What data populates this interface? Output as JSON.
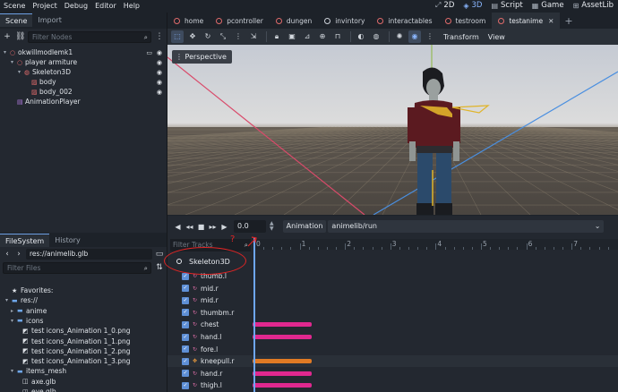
{
  "menubar": {
    "menus": [
      "Scene",
      "Project",
      "Debug",
      "Editor",
      "Help"
    ],
    "workspaces": [
      {
        "label": "2D",
        "icon": "2d-icon"
      },
      {
        "label": "3D",
        "icon": "3d-icon",
        "active": true
      },
      {
        "label": "Script",
        "icon": "script-icon"
      },
      {
        "label": "Game",
        "icon": "game-icon"
      },
      {
        "label": "AssetLib",
        "icon": "assetlib-icon"
      }
    ]
  },
  "scene_dock": {
    "tabs": [
      "Scene",
      "Import"
    ],
    "filter_placeholder": "Filter Nodes",
    "nodes": [
      {
        "label": "okwillmodlemk1",
        "depth": 0,
        "arrow": "▾",
        "icon": "node3d-icon"
      },
      {
        "label": "player armiture",
        "depth": 1,
        "arrow": "▾",
        "icon": "node3d-icon"
      },
      {
        "label": "Skeleton3D",
        "depth": 2,
        "arrow": "▾",
        "icon": "skeleton-icon"
      },
      {
        "label": "body",
        "depth": 3,
        "arrow": "",
        "icon": "mesh-icon"
      },
      {
        "label": "body_002",
        "depth": 3,
        "arrow": "",
        "icon": "mesh-icon"
      },
      {
        "label": "AnimationPlayer",
        "depth": 1,
        "arrow": "",
        "icon": "animplayer-icon"
      }
    ]
  },
  "filesystem_dock": {
    "tabs": [
      "FileSystem",
      "History"
    ],
    "path": "res://animelib.glb",
    "filter_placeholder": "Filter Files",
    "items": [
      {
        "label": "Favorites:",
        "depth": 0,
        "arrow": "",
        "icon": "star-icon"
      },
      {
        "label": "res://",
        "depth": 0,
        "arrow": "▾",
        "icon": "folder-icon"
      },
      {
        "label": "anime",
        "depth": 1,
        "arrow": "▸",
        "icon": "folder-icon"
      },
      {
        "label": "icons",
        "depth": 1,
        "arrow": "▾",
        "icon": "folder-icon"
      },
      {
        "label": "test icons_Animation 1_0.png",
        "depth": 2,
        "arrow": "",
        "icon": "image-icon"
      },
      {
        "label": "test icons_Animation 1_1.png",
        "depth": 2,
        "arrow": "",
        "icon": "image-icon"
      },
      {
        "label": "test icons_Animation 1_2.png",
        "depth": 2,
        "arrow": "",
        "icon": "image-icon"
      },
      {
        "label": "test icons_Animation 1_3.png",
        "depth": 2,
        "arrow": "",
        "icon": "image-icon"
      },
      {
        "label": "items_mesh",
        "depth": 1,
        "arrow": "▾",
        "icon": "folder-icon"
      },
      {
        "label": "axe.glb",
        "depth": 2,
        "arrow": "",
        "icon": "scene-file-icon"
      },
      {
        "label": "eye.glb",
        "depth": 2,
        "arrow": "",
        "icon": "scene-file-icon"
      }
    ]
  },
  "editor_tabs": [
    {
      "label": "home"
    },
    {
      "label": "pcontroller"
    },
    {
      "label": "dungen"
    },
    {
      "label": "invintory"
    },
    {
      "label": "interactables"
    },
    {
      "label": "testroom"
    },
    {
      "label": "testanime",
      "active": true
    }
  ],
  "viewport": {
    "transform_label": "Transform",
    "view_label": "View",
    "perspective_label": "Perspective"
  },
  "animation": {
    "time_value": "0.0",
    "animation_label": "Animation",
    "current_animation": "animelib/run",
    "filter_tracks_placeholder": "Filter Tracks",
    "ruler_numbers": [
      "0",
      "1",
      "2",
      "3",
      "4",
      "5",
      "6",
      "7"
    ],
    "annotation_glyph": "?",
    "root_track": "Skeleton3D",
    "tracks": [
      {
        "label": "thumb.l",
        "type": "rotation",
        "keyed": false
      },
      {
        "label": "mid.r",
        "type": "rotation",
        "keyed": false
      },
      {
        "label": "mid.r",
        "type": "rotation",
        "keyed": false
      },
      {
        "label": "thumbm.r",
        "type": "rotation",
        "keyed": false
      },
      {
        "label": "chest",
        "type": "rotation",
        "keyed": true
      },
      {
        "label": "hand.l",
        "type": "rotation",
        "keyed": true
      },
      {
        "label": "fore.l",
        "type": "rotation",
        "keyed": false
      },
      {
        "label": "kneepull.r",
        "type": "position",
        "keyed": true
      },
      {
        "label": "hand.r",
        "type": "rotation",
        "keyed": true
      },
      {
        "label": "thigh.l",
        "type": "rotation",
        "keyed": true
      }
    ],
    "colors": {
      "rotation_keys": "#e0288f",
      "position_keys": "#e07a24",
      "playhead": "#6ea6f3"
    }
  }
}
